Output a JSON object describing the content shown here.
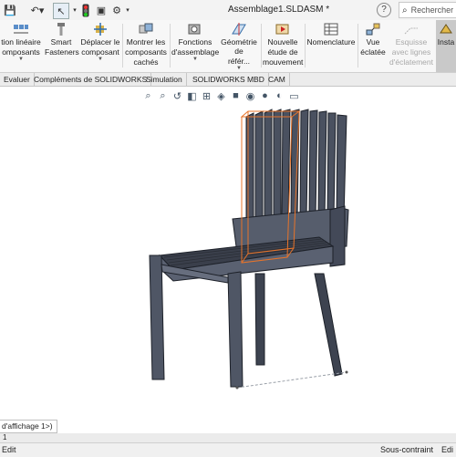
{
  "window": {
    "title": "Assemblage1.SLDASM *",
    "help": "?",
    "search_label": "Rechercher"
  },
  "quick_access": [
    "undo-icon",
    "select-icon",
    "traffic-light-icon",
    "rebuild-icon",
    "options-icon"
  ],
  "ribbon": {
    "buttons": [
      {
        "label": "tion linéaire",
        "label2": "omposants"
      },
      {
        "label": "Smart",
        "label2": "Fasteners"
      },
      {
        "label": "Déplacer le",
        "label2": "composant"
      },
      {
        "label": "Montrer les",
        "label2": "composants",
        "label3": "cachés"
      },
      {
        "label": "Fonctions",
        "label2": "d'assemblage"
      },
      {
        "label": "Géométrie de",
        "label2": "référ..."
      },
      {
        "label": "Nouvelle",
        "label2": "étude de",
        "label3": "mouvement"
      },
      {
        "label": "Nomenclature"
      },
      {
        "label": "Vue",
        "label2": "éclatée"
      },
      {
        "label": "Esquisse",
        "label2": "avec lignes",
        "label3": "d'éclatement"
      },
      {
        "label": "Insta"
      }
    ]
  },
  "tabs": [
    "Evaluer",
    "Compléments de SOLIDWORKS",
    "Simulation",
    "SOLIDWORKS MBD",
    "CAM"
  ],
  "status": {
    "display_state": "d'affichage 1>)",
    "model_tab": "1",
    "left": "Edit",
    "right": "Sous-contraint",
    "right2": "Edi"
  },
  "colors": {
    "ribbon_bg": "#f7f7f7",
    "chair_fill": "#4a5160",
    "chair_edge": "#1d2129",
    "highlight": "#e8742a"
  }
}
